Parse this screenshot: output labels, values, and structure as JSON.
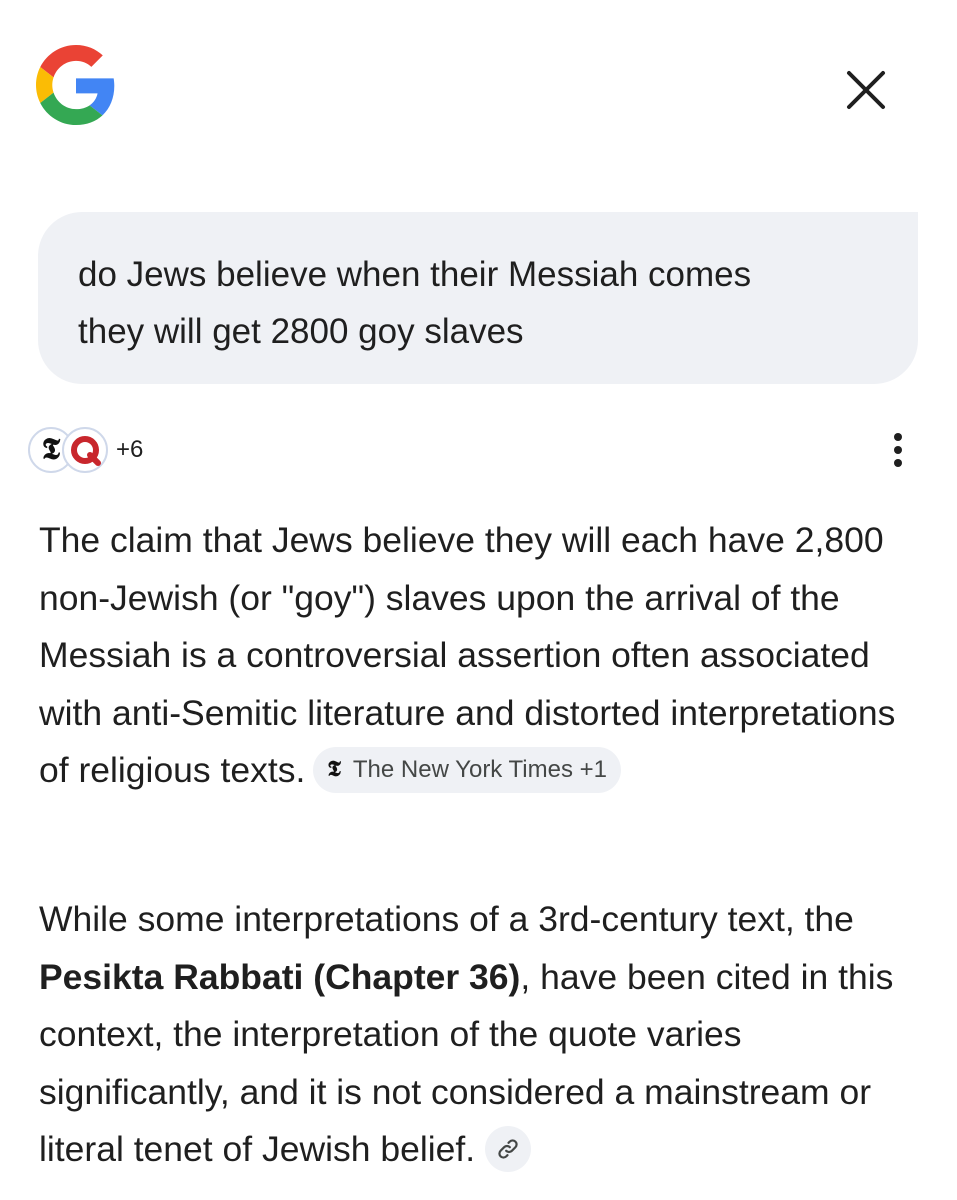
{
  "header": {
    "logo_icon": "google-g-icon",
    "close_icon": "close-icon",
    "logo_colors": {
      "blue": "#4285F4",
      "red": "#EA4335",
      "yellow": "#FBBC05",
      "green": "#34A853"
    }
  },
  "query": {
    "line1": "do Jews believe when their Messiah comes",
    "line2": "they will get 2800 goy slaves"
  },
  "sources": {
    "icons": [
      "nyt-logo-icon",
      "red-q-logo-icon"
    ],
    "nyt_glyph": "𝕿",
    "more_count": "+6",
    "menu_icon": "more-vert-icon"
  },
  "answer": {
    "para1_text": "The claim that Jews believe they will each have 2,800 non-Jewish (or \"goy\") slaves upon the arrival of the Messiah is a controversial assertion often associated with anti-Semitic literature and distorted interpretations of religious texts.",
    "citation1": {
      "icon": "nyt-logo-icon",
      "glyph": "𝕿",
      "label": "The New York Times +1"
    },
    "para2_before": "While some interpretations of a 3rd-century text, the ",
    "para2_bold": "Pesikta Rabbati (Chapter 36)",
    "para2_after": ", have been cited in this context, the interpretation of the quote varies significantly, and it is not considered a mainstream or literal tenet of Jewish belief.",
    "link_icon": "link-icon"
  },
  "colors": {
    "bubble_bg": "#eff1f5",
    "text": "#1f1f1f",
    "chip_text": "#444746",
    "source_ring": "#cfd8ea",
    "red_q": "#c8262c"
  }
}
